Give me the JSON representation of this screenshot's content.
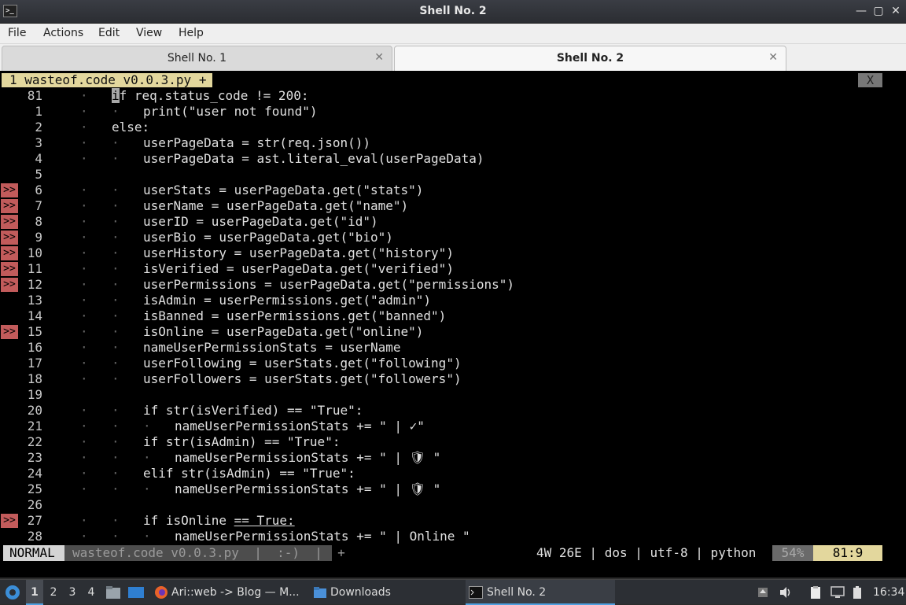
{
  "window": {
    "title": "Shell No. 2",
    "app_icon": ">_",
    "minimize": "—",
    "maximize": "▢",
    "close": "✕"
  },
  "menu": {
    "file": "File",
    "actions": "Actions",
    "edit": "Edit",
    "view": "View",
    "help": "Help"
  },
  "tabs": [
    {
      "label": "Shell No. 1",
      "close": "✕"
    },
    {
      "label": "Shell No. 2",
      "close": "✕"
    }
  ],
  "editor": {
    "buffer_tab": "1 wasteof.code v0.0.3.py +",
    "close_label": "X",
    "lines": [
      {
        "num": "81",
        "sign": "",
        "indent": 1,
        "code": "f req.status_code != 200:",
        "cursor": "i"
      },
      {
        "num": "1",
        "sign": "",
        "indent": 2,
        "code": "print(\"user not found\")"
      },
      {
        "num": "2",
        "sign": "",
        "indent": 1,
        "code": "else:"
      },
      {
        "num": "3",
        "sign": "",
        "indent": 2,
        "code": "userPageData = str(req.json())"
      },
      {
        "num": "4",
        "sign": "",
        "indent": 2,
        "code": "userPageData = ast.literal_eval(userPageData)"
      },
      {
        "num": "5",
        "sign": "",
        "indent": 0,
        "code": ""
      },
      {
        "num": "6",
        "sign": ">>",
        "indent": 2,
        "code": "userStats = userPageData.get(\"stats\")"
      },
      {
        "num": "7",
        "sign": ">>",
        "indent": 2,
        "code": "userName = userPageData.get(\"name\")"
      },
      {
        "num": "8",
        "sign": ">>",
        "indent": 2,
        "code": "userID = userPageData.get(\"id\")"
      },
      {
        "num": "9",
        "sign": ">>",
        "indent": 2,
        "code": "userBio = userPageData.get(\"bio\")"
      },
      {
        "num": "10",
        "sign": ">>",
        "indent": 2,
        "code": "userHistory = userPageData.get(\"history\")"
      },
      {
        "num": "11",
        "sign": ">>",
        "indent": 2,
        "code": "isVerified = userPageData.get(\"verified\")"
      },
      {
        "num": "12",
        "sign": ">>",
        "indent": 2,
        "code": "userPermissions = userPageData.get(\"permissions\")"
      },
      {
        "num": "13",
        "sign": "",
        "indent": 2,
        "code": "isAdmin = userPermissions.get(\"admin\")"
      },
      {
        "num": "14",
        "sign": "",
        "indent": 2,
        "code": "isBanned = userPermissions.get(\"banned\")"
      },
      {
        "num": "15",
        "sign": ">>",
        "indent": 2,
        "code": "isOnline = userPageData.get(\"online\")"
      },
      {
        "num": "16",
        "sign": "",
        "indent": 2,
        "code": "nameUserPermissionStats = userName"
      },
      {
        "num": "17",
        "sign": "",
        "indent": 2,
        "code": "userFollowing = userStats.get(\"following\")"
      },
      {
        "num": "18",
        "sign": "",
        "indent": 2,
        "code": "userFollowers = userStats.get(\"followers\")"
      },
      {
        "num": "19",
        "sign": "",
        "indent": 0,
        "code": ""
      },
      {
        "num": "20",
        "sign": "",
        "indent": 2,
        "code": "if str(isVerified) == \"True\":"
      },
      {
        "num": "21",
        "sign": "",
        "indent": 3,
        "code": "nameUserPermissionStats += \" | ✓\""
      },
      {
        "num": "22",
        "sign": "",
        "indent": 2,
        "code": "if str(isAdmin) == \"True\":"
      },
      {
        "num": "23",
        "sign": "",
        "indent": 3,
        "code": "nameUserPermissionStats += \" | 🛡 \""
      },
      {
        "num": "24",
        "sign": "",
        "indent": 2,
        "code": "elif str(isAdmin) == \"True\":"
      },
      {
        "num": "25",
        "sign": "",
        "indent": 3,
        "code": "nameUserPermissionStats += \" | 🛡 \""
      },
      {
        "num": "26",
        "sign": "",
        "indent": 0,
        "code": ""
      },
      {
        "num": "27",
        "sign": ">>",
        "indent": 2,
        "code": "if isOnline ",
        "underline": "== True:"
      },
      {
        "num": "28",
        "sign": "",
        "indent": 3,
        "code": "nameUserPermissionStats += \" | Online \""
      }
    ]
  },
  "statusline": {
    "mode": "NORMAL",
    "file": "wasteof.code v0.0.3.py  |  :-)  |  +",
    "info": "4W 26E | dos | utf-8 | python",
    "percent": "54%",
    "position": "81:9"
  },
  "taskbar": {
    "workspaces": [
      "1",
      "2",
      "3",
      "4"
    ],
    "tasks": [
      {
        "label": "Ari::web -> Blog — M...",
        "icon": "firefox-icon"
      },
      {
        "label": "Downloads",
        "icon": "folder-icon"
      },
      {
        "label": "Shell No. 2",
        "icon": "terminal-icon"
      }
    ],
    "clock": "16:34"
  }
}
